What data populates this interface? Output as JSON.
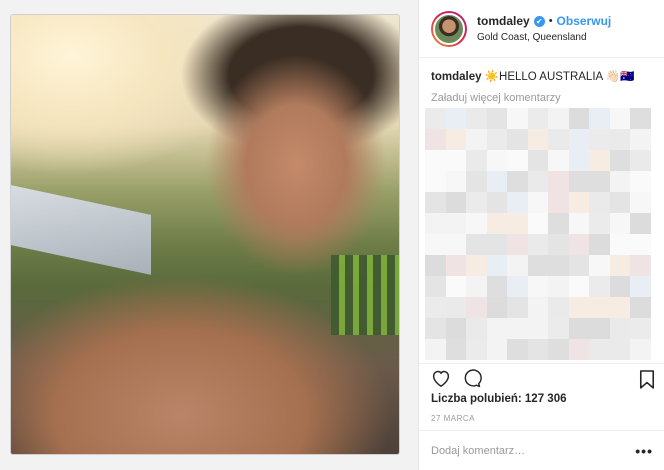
{
  "post": {
    "username": "tomdaley",
    "verified_mark": "✔",
    "separator": "•",
    "follow_label": "Obserwuj",
    "location": "Gold Coast, Queensland",
    "caption_user": "tomdaley",
    "caption_text": " ☀️HELLO AUSTRALIA 👋🏻🇦🇺",
    "load_more_label": "Załaduj więcej komentarzy",
    "likes_label": "Liczba polubień: 127 306",
    "date": "27 MARCA",
    "comment_placeholder": "Dodaj komentarz…",
    "more_label": "•••"
  },
  "icons": [
    "heart-icon",
    "comment-icon",
    "bookmark-icon",
    "verified-icon",
    "more-options-icon"
  ],
  "colors": {
    "accent": "#3897f0",
    "text": "#262626",
    "muted": "#999999"
  }
}
